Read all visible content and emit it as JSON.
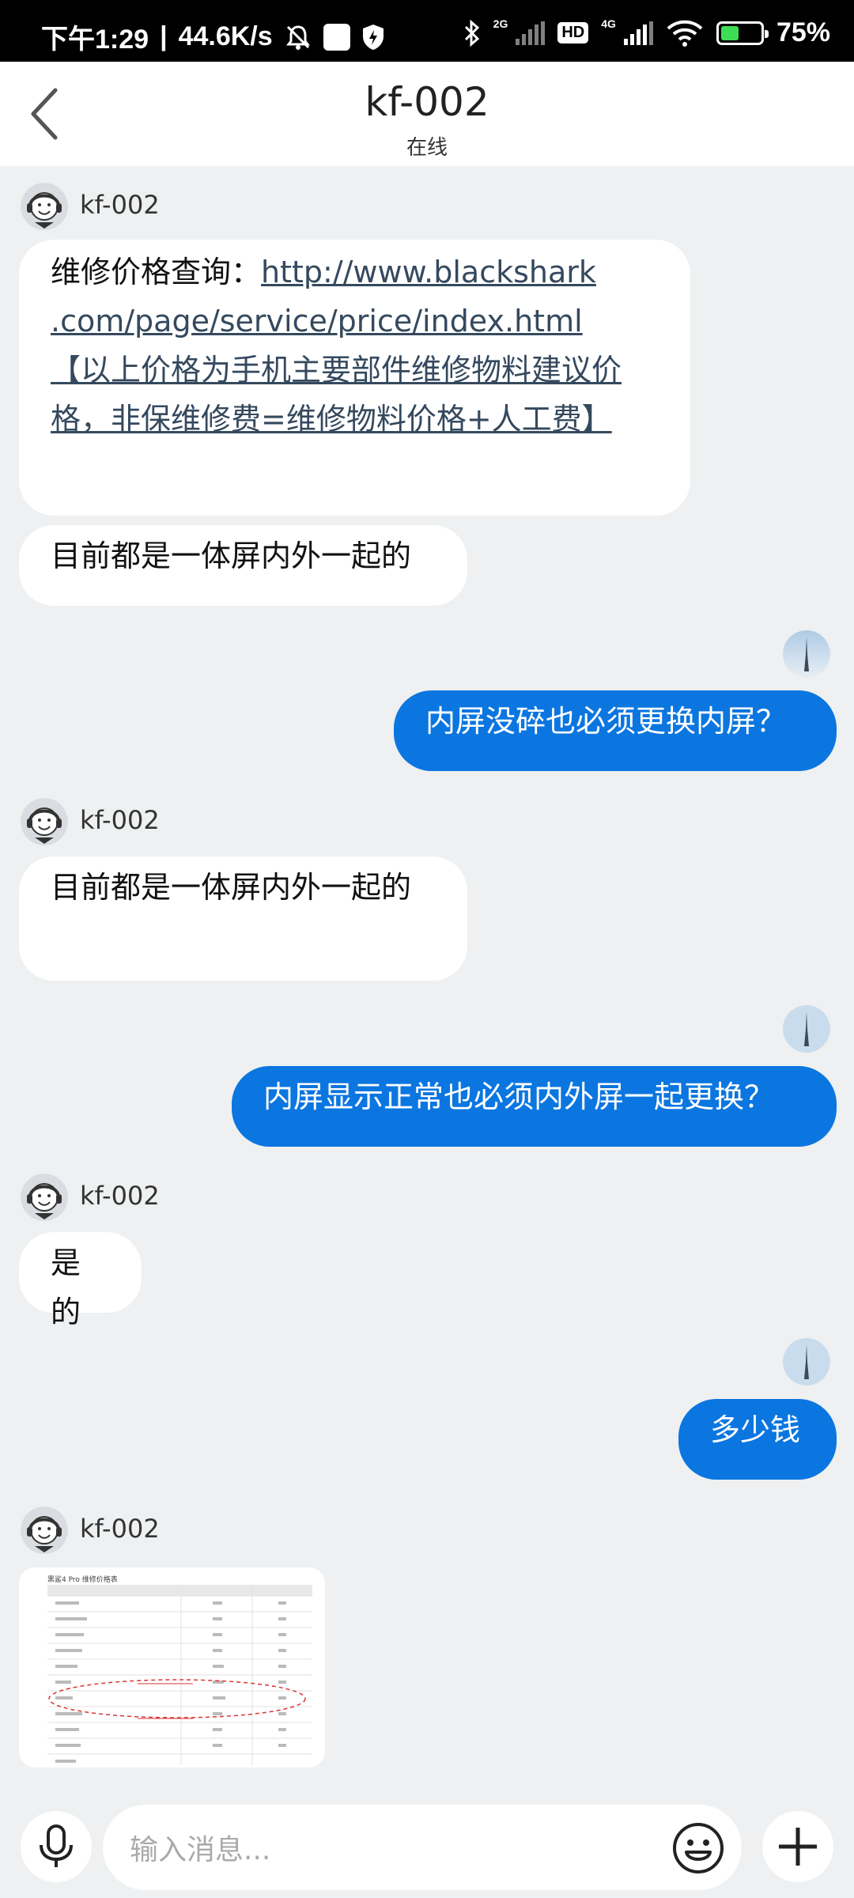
{
  "status_bar": {
    "time": "下午1:29",
    "net_speed": "44.6K/s",
    "sig_label_1": "2G",
    "sig_label_2": "4G",
    "hd": "HD",
    "battery": "75%"
  },
  "header": {
    "title": "kf-002",
    "subtitle": "在线"
  },
  "messages": [
    {
      "sender": "kf-002",
      "prefix": "维修价格查询：",
      "link_line1": "http://www.blackshark",
      "link_line2": ".com/page/service/price/index.html",
      "link_line3": "【以上价格为手机主要部件维修物料建议价",
      "link_line4": "格，非保维修费=维修物料价格+人工费】"
    },
    {
      "text": "目前都是一体屏内外一起的"
    },
    {
      "text": "内屏没碎也必须更换内屏？"
    },
    {
      "sender": "kf-002",
      "text": "目前都是一体屏内外一起的"
    },
    {
      "text": "内屏显示正常也必须内外屏一起更换？"
    },
    {
      "sender": "kf-002",
      "text": "是的"
    },
    {
      "text": "多少钱"
    },
    {
      "sender": "kf-002",
      "image_title": "黑鲨4 Pro 维修价格表"
    }
  ],
  "input": {
    "placeholder": "输入消息..."
  },
  "icons": {
    "back": "chevron-left-icon",
    "mic": "microphone-icon",
    "emoji": "emoji-icon",
    "plus": "plus-icon"
  },
  "colors": {
    "accent": "#0b76e0",
    "background": "#eef0f1"
  }
}
